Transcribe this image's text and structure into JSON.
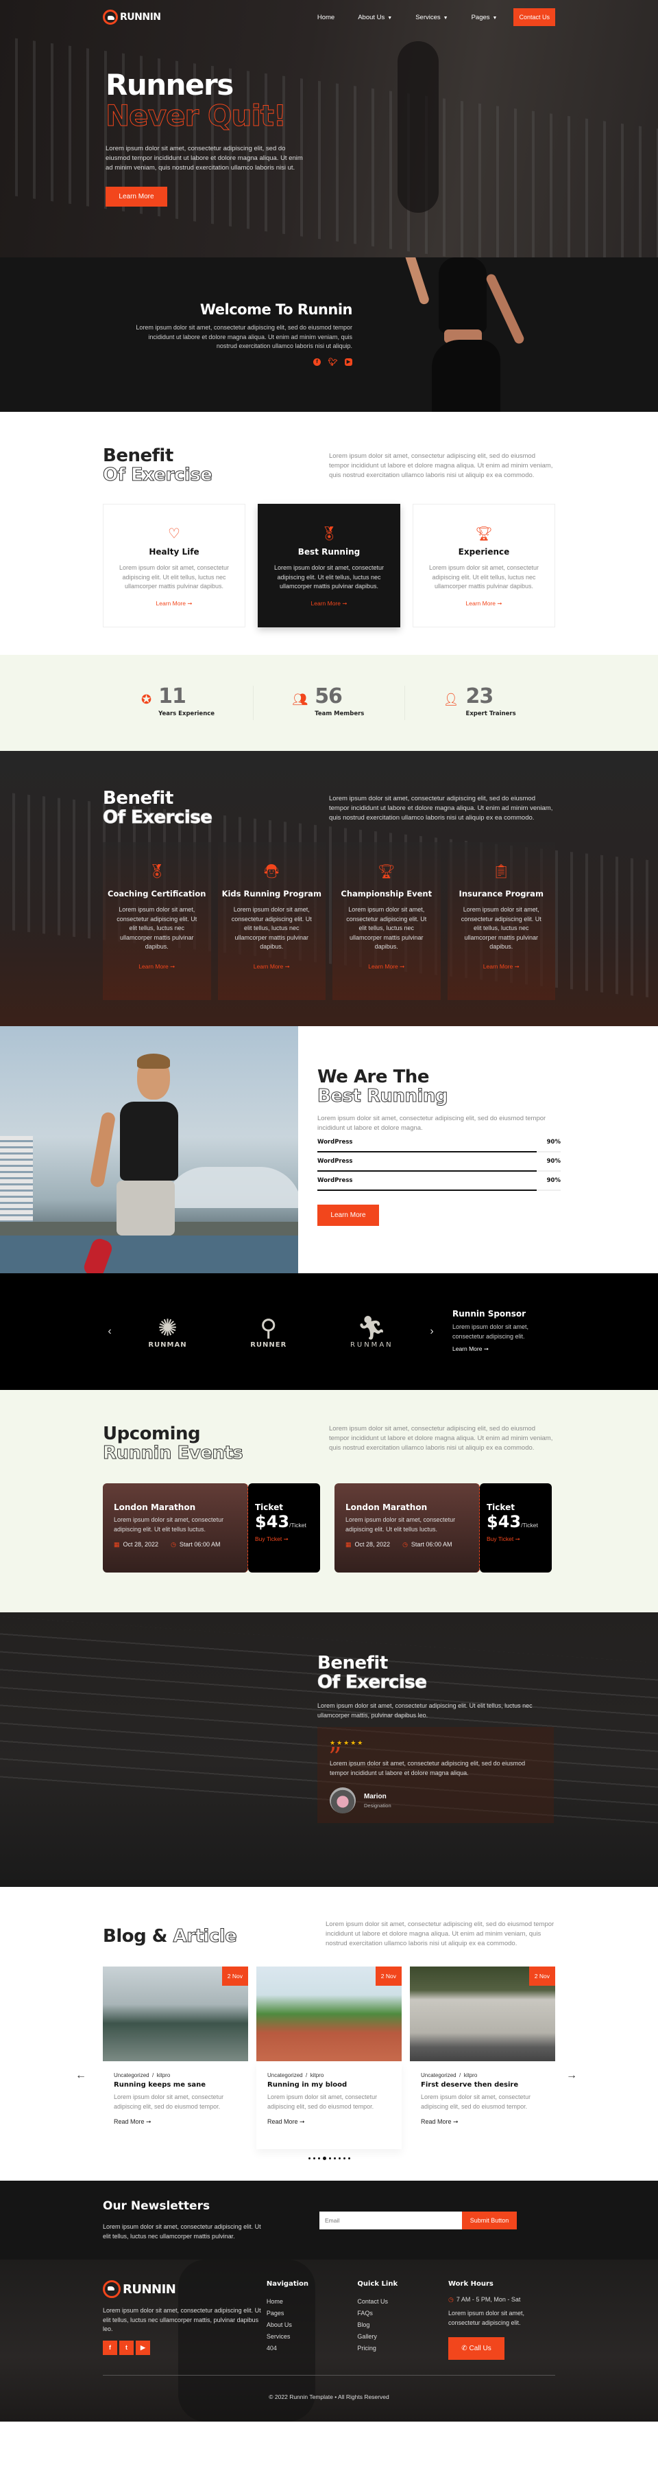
{
  "brand": {
    "name": "RUNNIN",
    "accent": "#f2461c"
  },
  "nav": {
    "items": [
      {
        "label": "Home",
        "dropdown": false
      },
      {
        "label": "About Us",
        "dropdown": true
      },
      {
        "label": "Services",
        "dropdown": true
      },
      {
        "label": "Pages",
        "dropdown": true
      }
    ],
    "cta": "Contact Us"
  },
  "hero": {
    "line1": "Runners",
    "line2": "Never Quit!",
    "text": "Lorem ipsum dolor sit amet, consectetur adipiscing elit, sed do eiusmod tempor incididunt ut labore et dolore magna aliqua. Ut enim ad minim veniam, quis nostrud exercitation ullamco laboris nisi ut.",
    "button": "Learn More"
  },
  "welcome": {
    "title": "Welcome To Runnin",
    "text": "Lorem ipsum dolor sit amet, consectetur adipiscing elit, sed do eiusmod tempor incididunt ut labore et dolore magna aliqua. Ut enim ad minim veniam, quis nostrud exercitation ullamco laboris nisi ut aliquip.",
    "socials": [
      "facebook",
      "twitter",
      "youtube"
    ]
  },
  "benefit1": {
    "title1": "Benefit",
    "title2": "Of Exercise",
    "text": "Lorem ipsum dolor sit amet, consectetur adipiscing elit, sed do eiusmod tempor incididunt ut labore et dolore magna aliqua. Ut enim ad minim veniam, quis nostrud exercitation ullamco laboris nisi ut aliquip ex ea commodo.",
    "cards": [
      {
        "icon": "heartbeat-icon",
        "title": "Healty Life",
        "text": "Lorem ipsum dolor sit amet, consectetur adipiscing elit. Ut elit tellus, luctus nec ullamcorper mattis pulvinar dapibus.",
        "link": "Learn More ➞"
      },
      {
        "icon": "medal-icon",
        "title": "Best Running",
        "text": "Lorem ipsum dolor sit amet, consectetur adipiscing elit. Ut elit tellus, luctus nec ullamcorper mattis pulvinar dapibus.",
        "link": "Learn More ➞"
      },
      {
        "icon": "trophy-icon",
        "title": "Experience",
        "text": "Lorem ipsum dolor sit amet, consectetur adipiscing elit. Ut elit tellus, luctus nec ullamcorper mattis pulvinar dapibus.",
        "link": "Learn More ➞"
      }
    ]
  },
  "stats": [
    {
      "icon": "award-icon",
      "value": "11",
      "label": "Years Experience"
    },
    {
      "icon": "team-icon",
      "value": "56",
      "label": "Team Members"
    },
    {
      "icon": "trainer-icon",
      "value": "23",
      "label": "Expert Trainers"
    }
  ],
  "benefit2": {
    "title1": "Benefit",
    "title2": "Of Exercise",
    "text": "Lorem ipsum dolor sit amet, consectetur adipiscing elit, sed do eiusmod tempor incididunt ut labore et dolore magna aliqua. Ut enim ad minim veniam, quis nostrud exercitation ullamco laboris nisi ut aliquip ex ea commodo.",
    "cards": [
      {
        "icon": "medal-icon",
        "title": "Coaching Certification",
        "text": "Lorem ipsum dolor sit amet, consectetur adipiscing elit. Ut elit tellus, luctus nec ullamcorper mattis pulvinar dapibus.",
        "link": "Learn More ➞"
      },
      {
        "icon": "kid-icon",
        "title": "Kids Running Program",
        "text": "Lorem ipsum dolor sit amet, consectetur adipiscing elit. Ut elit tellus, luctus nec ullamcorper mattis pulvinar dapibus.",
        "link": "Learn More ➞"
      },
      {
        "icon": "trophy-icon",
        "title": "Championship Event",
        "text": "Lorem ipsum dolor sit amet, consectetur adipiscing elit. Ut elit tellus, luctus nec ullamcorper mattis pulvinar dapibus.",
        "link": "Learn More ➞"
      },
      {
        "icon": "clipboard-icon",
        "title": "Insurance Program",
        "text": "Lorem ipsum dolor sit amet, consectetur adipiscing elit. Ut elit tellus, luctus nec ullamcorper mattis pulvinar dapibus.",
        "link": "Learn More ➞"
      }
    ]
  },
  "best": {
    "title1": "We Are The",
    "title2": "Best Running",
    "text": "Lorem ipsum dolor sit amet, consectetur adipiscing elit, sed do eiusmod tempor incididunt ut labore et dolore magna.",
    "skills": [
      {
        "label": "WordPress",
        "value": "90%",
        "percent": 90
      },
      {
        "label": "WordPress",
        "value": "90%",
        "percent": 90
      },
      {
        "label": "WordPress",
        "value": "90%",
        "percent": 90
      }
    ],
    "button": "Learn More"
  },
  "sponsor": {
    "logos": [
      {
        "name": "RUNMAN",
        "mark": "✺"
      },
      {
        "name": "RUNNER",
        "mark": "⚲"
      },
      {
        "name": "RUNMAN",
        "mark": "🏃︎"
      }
    ],
    "title": "Runnin Sponsor",
    "text": "Lorem ipsum dolor sit amet, consectetur adipiscing elit.",
    "link": "Learn More ➞",
    "prev": "‹",
    "next": "›"
  },
  "events": {
    "title1": "Upcoming",
    "title2": "Runnin Events",
    "text": "Lorem ipsum dolor sit amet, consectetur adipiscing elit, sed do eiusmod tempor incididunt ut labore et dolore magna aliqua. Ut enim ad minim veniam, quis nostrud exercitation ullamco laboris nisi ut aliquip ex ea commodo.",
    "items": [
      {
        "title": "London Marathon",
        "text": "Lorem ipsum dolor sit amet, consectetur adipiscing elit. Ut elit tellus luctus.",
        "date": "Oct 28, 2022",
        "time": "Start 06:00 AM",
        "ticket_label": "Ticket",
        "price": "$43",
        "per": "/Ticket",
        "buy": "Buy Ticket ➞"
      },
      {
        "title": "London Marathon",
        "text": "Lorem ipsum dolor sit amet, consectetur adipiscing elit. Ut elit tellus luctus.",
        "date": "Oct 28, 2022",
        "time": "Start 06:00 AM",
        "ticket_label": "Ticket",
        "price": "$43",
        "per": "/Ticket",
        "buy": "Buy Ticket ➞"
      }
    ]
  },
  "testimonial": {
    "title1": "Benefit",
    "title2": "Of Exercise",
    "intro": "Lorem ipsum dolor sit amet, consectetur adipiscing elit. Ut elit tellus, luctus nec ullamcorper mattis, pulvinar dapibus leo.",
    "rating": 5,
    "stars": "★★★★★",
    "quote": "Lorem ipsum dolor sit amet, consectetur adipiscing elit, sed do eiusmod tempor incididunt ut labore et dolore magna aliqua.",
    "name": "Marion",
    "designation": "Designation"
  },
  "blog": {
    "title1": "Blog &",
    "title2": "Article",
    "text": "Lorem ipsum dolor sit amet, consectetur adipiscing elit, sed do eiusmod tempor incididunt ut labore et dolore magna aliqua. Ut enim ad minim veniam, quis nostrud exercitation ullamco laboris nisi ut aliquip ex ea commodo.",
    "posts": [
      {
        "date": "2 Nov",
        "category": "Uncategorized",
        "author": "kitpro",
        "title": "Running keeps me sane",
        "text": "Lorem ipsum dolor sit amet, consectetur adipiscing elit, sed do eiusmod tempor.",
        "link": "Read More ➞"
      },
      {
        "date": "2 Nov",
        "category": "Uncategorized",
        "author": "kitpro",
        "title": "Running in my blood",
        "text": "Lorem ipsum dolor sit amet, consectetur adipiscing elit, sed do eiusmod tempor.",
        "link": "Read More ➞"
      },
      {
        "date": "2 Nov",
        "category": "Uncategorized",
        "author": "kitpro",
        "title": "First deserve then desire",
        "text": "Lorem ipsum dolor sit amet, consectetur adipiscing elit, sed do eiusmod tempor.",
        "link": "Read More ➞"
      }
    ],
    "sep": "/",
    "prev": "←",
    "next": "→",
    "dots_total": 9,
    "dots_active": 4
  },
  "newsletter": {
    "title": "Our Newsletters",
    "text": "Lorem ipsum dolor sit amet, consectetur adipiscing elit. Ut elit tellus, luctus nec ullamcorper mattis pulvinar.",
    "placeholder": "Email",
    "value": "",
    "button": "Submit Button"
  },
  "footer": {
    "about": "Lorem ipsum dolor sit amet, consectetur adipiscing elit. Ut elit tellus, luctus nec ullamcorper mattis, pulvinar dapibus leo.",
    "socials": [
      "facebook",
      "twitter",
      "youtube"
    ],
    "nav_title": "Navigation",
    "nav_links": [
      "Home",
      "Pages",
      "About Us",
      "Services",
      "404"
    ],
    "quick_title": "Quick Link",
    "quick_links": [
      "Contact Us",
      "FAQs",
      "Blog",
      "Gallery",
      "Pricing"
    ],
    "hours_title": "Work Hours",
    "hours": "7 AM - 5 PM, Mon - Sat",
    "hours_text": "Lorem ipsum dolor sit amet, consectetur adipiscing elit.",
    "call": "Call Us",
    "copyright": "© 2022 Runnin Template • All Rights Reserved"
  }
}
